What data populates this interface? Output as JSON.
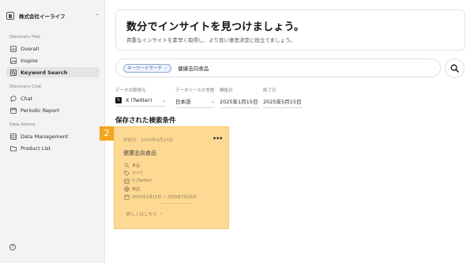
{
  "sidebar": {
    "org_name": "株式会社イーライフ",
    "sections": {
      "discovery_hub": "Discovery Hub",
      "discovery_chat": "Discovery Chat",
      "data_source": "Data Source"
    },
    "items": [
      {
        "label": "Overall",
        "icon": "chart-icon"
      },
      {
        "label": "Inspire",
        "icon": "image-icon"
      },
      {
        "label": "Keyword Search",
        "icon": "search-icon",
        "active": true
      },
      {
        "label": "Chat",
        "icon": "chat-icon"
      },
      {
        "label": "Periodic Report",
        "icon": "calendar-icon"
      },
      {
        "label": "Data Management",
        "icon": "database-icon"
      },
      {
        "label": "Product List",
        "icon": "folder-icon"
      }
    ]
  },
  "hero": {
    "title": "数分でインサイトを見つけましょう。",
    "subtitle": "貴重なインサイトを素早く取得し、より良い意思決定に役立てましょう。"
  },
  "search": {
    "chip_label": "キーワードサーチ",
    "query": "健康志向食品"
  },
  "filters": {
    "source_label": "データの取得元",
    "source_value": "X (Twitter)",
    "language_label": "データソースの言語",
    "language_value": "日本語",
    "start_label": "開始日",
    "start_value": "2025年1月15日",
    "end_label": "終了日",
    "end_value": "2025年5月15日"
  },
  "saved": {
    "title": "保存された検索条件",
    "badge": "2",
    "card": {
      "created": "作成日：2024年3月13日",
      "keyword": "健康志向食品",
      "category": "食品",
      "scope": "すべて",
      "source": "X (Twitter)",
      "language": "英語",
      "period": "2025年1月15日 ~ 2025年7月15日",
      "details_label": "詳しくはこちら"
    }
  },
  "colors": {
    "sidebar_bg": "#f3f3f4",
    "card_bg": "#fdd993",
    "badge_bg": "#f3a51e",
    "chip_border": "#8aa6d8"
  }
}
